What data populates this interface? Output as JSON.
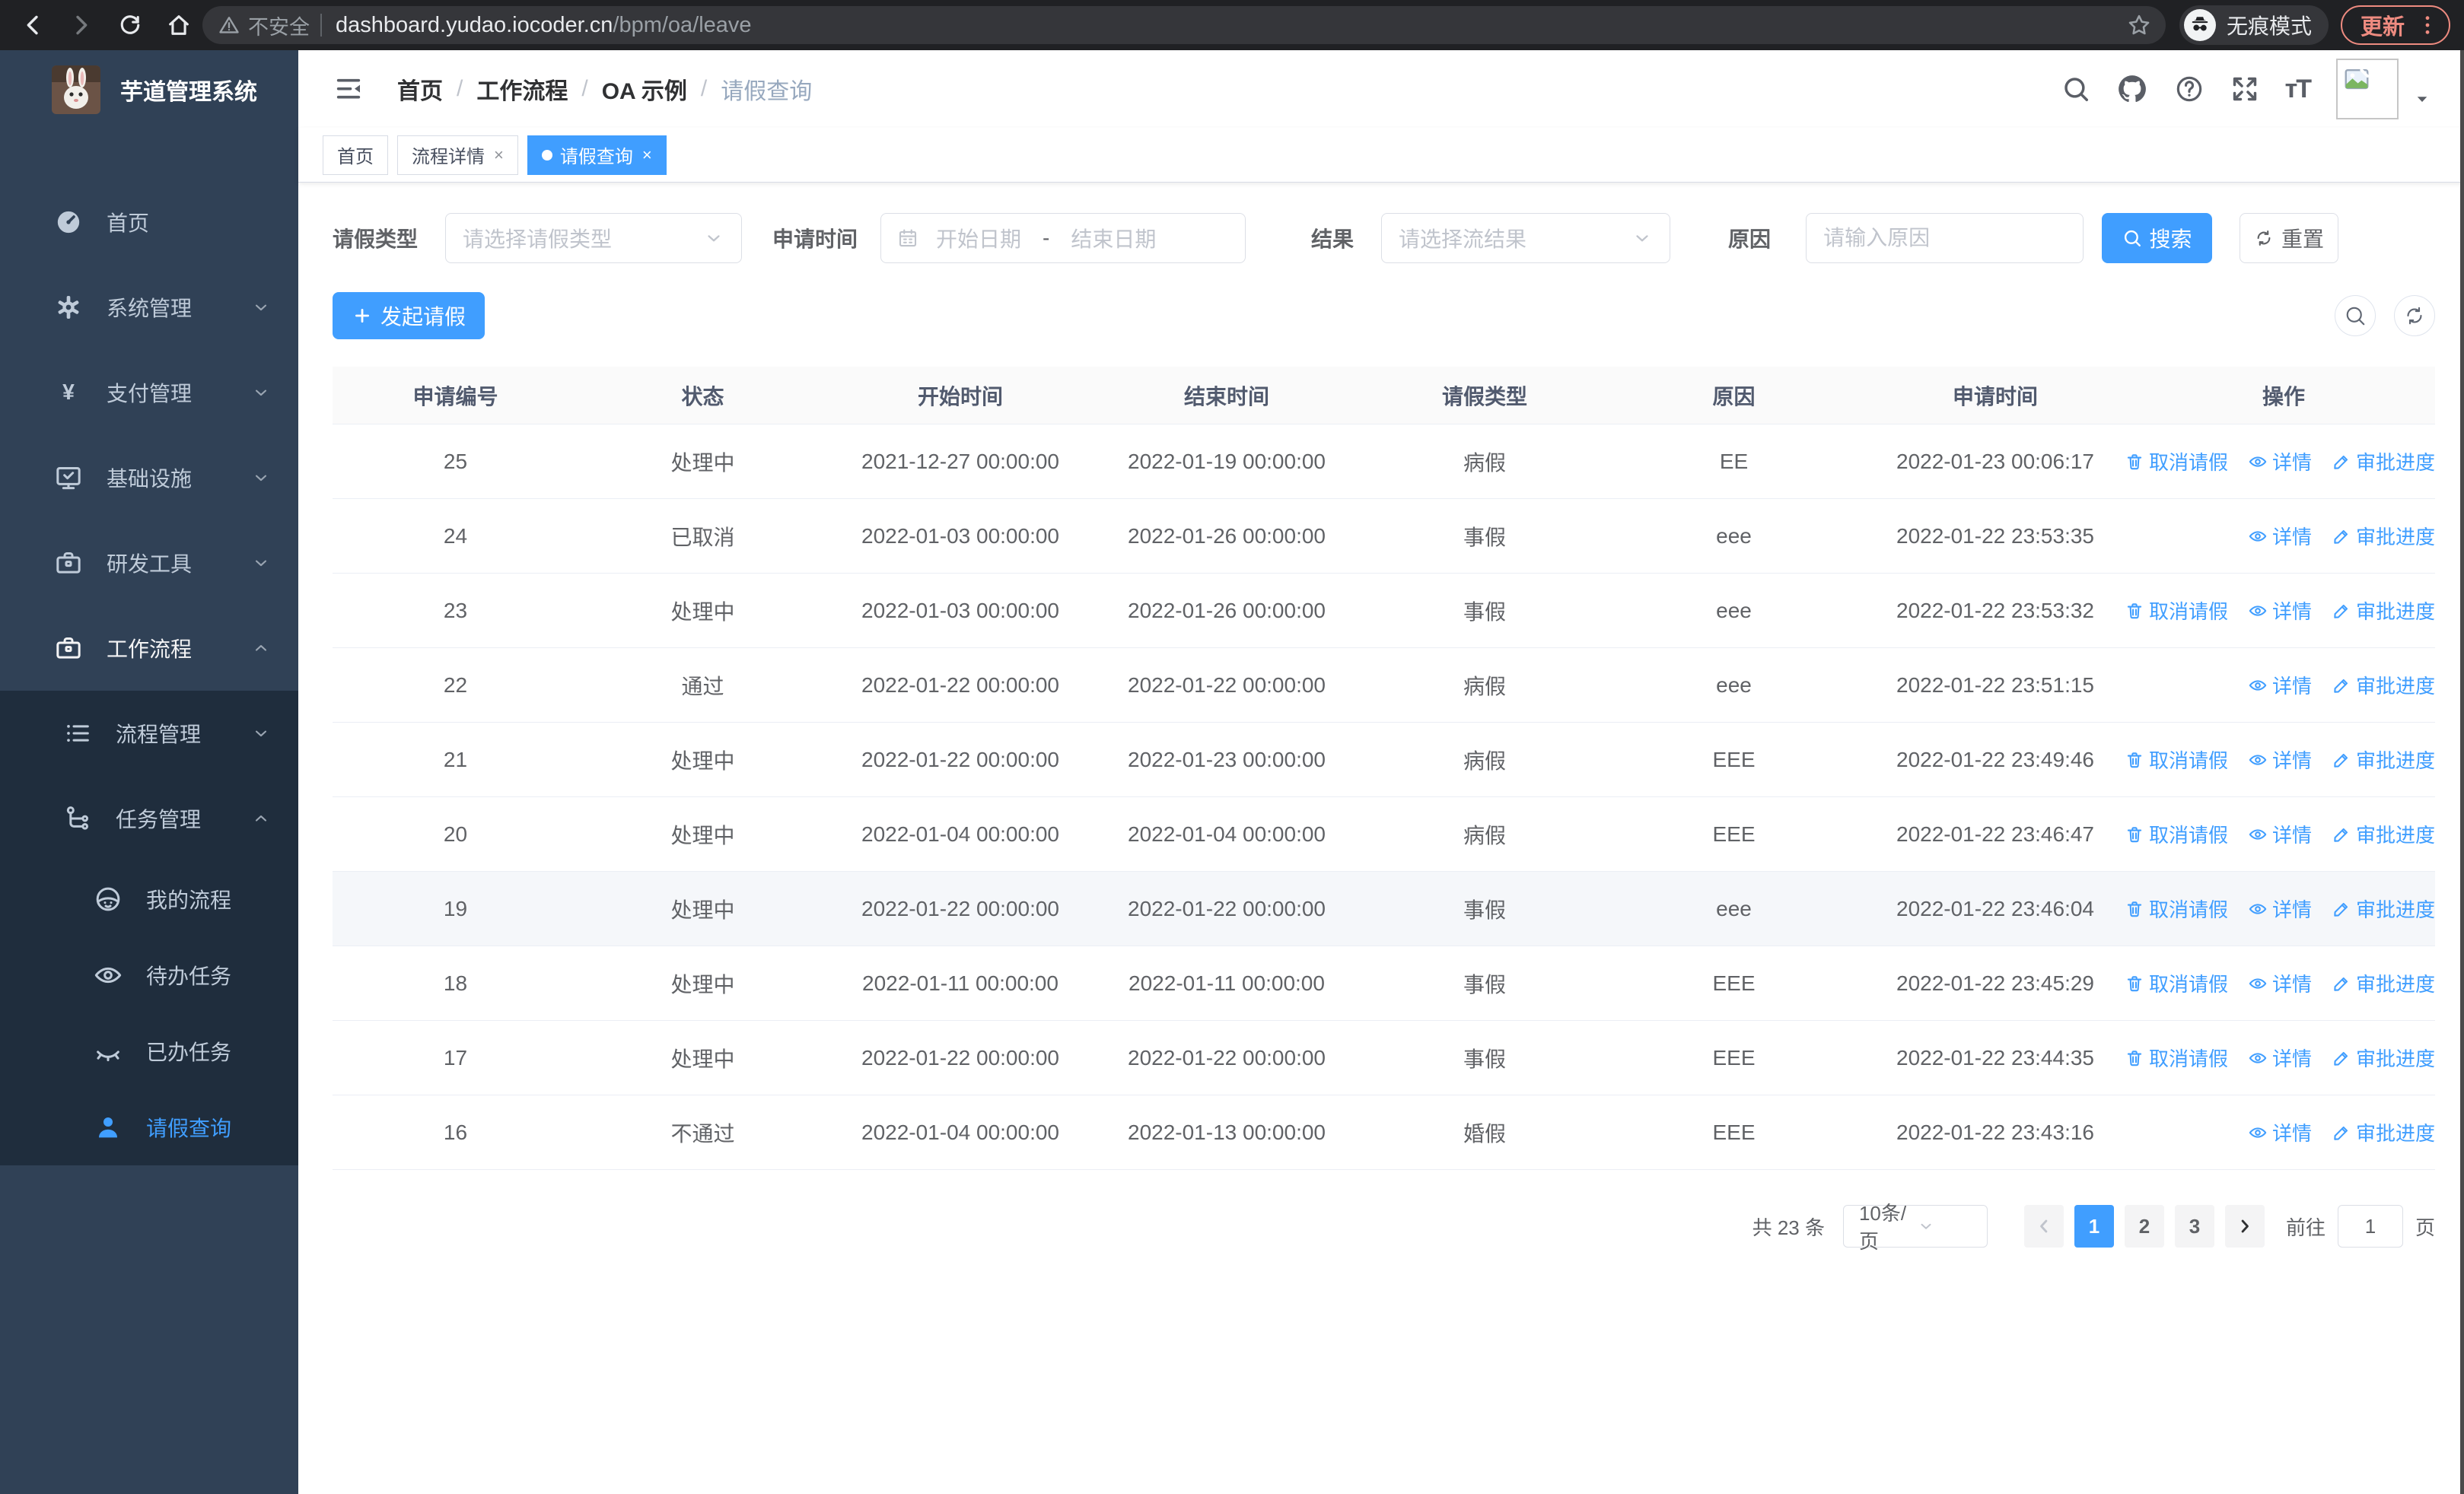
{
  "browser": {
    "security_label": "不安全",
    "url_domain": "dashboard.yudao.iocoder.cn",
    "url_path": "/bpm/oa/leave",
    "incognito_label": "无痕模式",
    "update_label": "更新"
  },
  "sidebar": {
    "title": "芋道管理系统",
    "menu": [
      {
        "name": "home",
        "label": "首页",
        "icon": "gauge-icon",
        "chevron": null,
        "level": 0
      },
      {
        "name": "system-management",
        "label": "系统管理",
        "icon": "gear-icon",
        "chevron": "down",
        "level": 0
      },
      {
        "name": "payment-management",
        "label": "支付管理",
        "icon": "yen-icon",
        "chevron": "down",
        "level": 0
      },
      {
        "name": "infrastructure",
        "label": "基础设施",
        "icon": "monitor-icon",
        "chevron": "down",
        "level": 0
      },
      {
        "name": "dev-tools",
        "label": "研发工具",
        "icon": "toolbox-icon",
        "chevron": "down",
        "level": 0
      },
      {
        "name": "workflow",
        "label": "工作流程",
        "icon": "toolbox-icon",
        "chevron": "up",
        "level": 0,
        "open": true
      }
    ],
    "submenu": [
      {
        "name": "process-management",
        "label": "流程管理",
        "icon": "list-icon",
        "chevron": "down",
        "level": 1
      },
      {
        "name": "task-management",
        "label": "任务管理",
        "icon": "tree-icon",
        "chevron": "up",
        "level": 1
      },
      {
        "name": "my-process",
        "label": "我的流程",
        "icon": "face-icon",
        "level": 2
      },
      {
        "name": "todo-tasks",
        "label": "待办任务",
        "icon": "eye-icon",
        "level": 2
      },
      {
        "name": "done-tasks",
        "label": "已办任务",
        "icon": "eye-closed-icon",
        "level": 2
      },
      {
        "name": "leave-query",
        "label": "请假查询",
        "icon": "user-icon",
        "level": 2,
        "active": true
      }
    ]
  },
  "header": {
    "breadcrumb": [
      "首页",
      "工作流程",
      "OA 示例",
      "请假查询"
    ],
    "tabs": [
      {
        "name": "tab-home",
        "label": "首页",
        "closable": false,
        "active": false
      },
      {
        "name": "tab-process-detail",
        "label": "流程详情",
        "closable": true,
        "active": false
      },
      {
        "name": "tab-leave-query",
        "label": "请假查询",
        "closable": true,
        "active": true
      }
    ]
  },
  "filters": {
    "leave_type_label": "请假类型",
    "leave_type_placeholder": "请选择请假类型",
    "apply_time_label": "申请时间",
    "date_start_placeholder": "开始日期",
    "date_separator": "-",
    "date_end_placeholder": "结束日期",
    "result_label": "结果",
    "result_placeholder": "请选择流结果",
    "reason_label": "原因",
    "reason_placeholder": "请输入原因",
    "search_label": "搜索",
    "reset_label": "重置"
  },
  "toolbar": {
    "create_label": "发起请假"
  },
  "table": {
    "columns": [
      "申请编号",
      "状态",
      "开始时间",
      "结束时间",
      "请假类型",
      "原因",
      "申请时间",
      "操作"
    ],
    "action_labels": {
      "cancel": "取消请假",
      "detail": "详情",
      "progress": "审批进度"
    },
    "rows": [
      {
        "id": "25",
        "status": "处理中",
        "start": "2021-12-27 00:00:00",
        "end": "2022-01-19 00:00:00",
        "type": "病假",
        "reason": "EE",
        "apply": "2022-01-23 00:06:17",
        "actions": [
          "cancel",
          "detail",
          "progress"
        ],
        "highlight": false
      },
      {
        "id": "24",
        "status": "已取消",
        "start": "2022-01-03 00:00:00",
        "end": "2022-01-26 00:00:00",
        "type": "事假",
        "reason": "eee",
        "apply": "2022-01-22 23:53:35",
        "actions": [
          "detail",
          "progress"
        ],
        "highlight": false
      },
      {
        "id": "23",
        "status": "处理中",
        "start": "2022-01-03 00:00:00",
        "end": "2022-01-26 00:00:00",
        "type": "事假",
        "reason": "eee",
        "apply": "2022-01-22 23:53:32",
        "actions": [
          "cancel",
          "detail",
          "progress"
        ],
        "highlight": false
      },
      {
        "id": "22",
        "status": "通过",
        "start": "2022-01-22 00:00:00",
        "end": "2022-01-22 00:00:00",
        "type": "病假",
        "reason": "eee",
        "apply": "2022-01-22 23:51:15",
        "actions": [
          "detail",
          "progress"
        ],
        "highlight": false
      },
      {
        "id": "21",
        "status": "处理中",
        "start": "2022-01-22 00:00:00",
        "end": "2022-01-23 00:00:00",
        "type": "病假",
        "reason": "EEE",
        "apply": "2022-01-22 23:49:46",
        "actions": [
          "cancel",
          "detail",
          "progress"
        ],
        "highlight": false
      },
      {
        "id": "20",
        "status": "处理中",
        "start": "2022-01-04 00:00:00",
        "end": "2022-01-04 00:00:00",
        "type": "病假",
        "reason": "EEE",
        "apply": "2022-01-22 23:46:47",
        "actions": [
          "cancel",
          "detail",
          "progress"
        ],
        "highlight": false
      },
      {
        "id": "19",
        "status": "处理中",
        "start": "2022-01-22 00:00:00",
        "end": "2022-01-22 00:00:00",
        "type": "事假",
        "reason": "eee",
        "apply": "2022-01-22 23:46:04",
        "actions": [
          "cancel",
          "detail",
          "progress"
        ],
        "highlight": true
      },
      {
        "id": "18",
        "status": "处理中",
        "start": "2022-01-11 00:00:00",
        "end": "2022-01-11 00:00:00",
        "type": "事假",
        "reason": "EEE",
        "apply": "2022-01-22 23:45:29",
        "actions": [
          "cancel",
          "detail",
          "progress"
        ],
        "highlight": false
      },
      {
        "id": "17",
        "status": "处理中",
        "start": "2022-01-22 00:00:00",
        "end": "2022-01-22 00:00:00",
        "type": "事假",
        "reason": "EEE",
        "apply": "2022-01-22 23:44:35",
        "actions": [
          "cancel",
          "detail",
          "progress"
        ],
        "highlight": false
      },
      {
        "id": "16",
        "status": "不通过",
        "start": "2022-01-04 00:00:00",
        "end": "2022-01-13 00:00:00",
        "type": "婚假",
        "reason": "EEE",
        "apply": "2022-01-22 23:43:16",
        "actions": [
          "detail",
          "progress"
        ],
        "highlight": false
      }
    ]
  },
  "pagination": {
    "total_label": "共 23 条",
    "page_size": "10条/页",
    "pages": [
      "1",
      "2",
      "3"
    ],
    "active_page": "1",
    "goto_label": "前往",
    "goto_value": "1",
    "page_unit": "页"
  },
  "colors": {
    "primary": "#409eff",
    "sidebar_bg": "#304156",
    "submenu_bg": "#1f2d3d",
    "update_accent": "#ee8b80"
  }
}
